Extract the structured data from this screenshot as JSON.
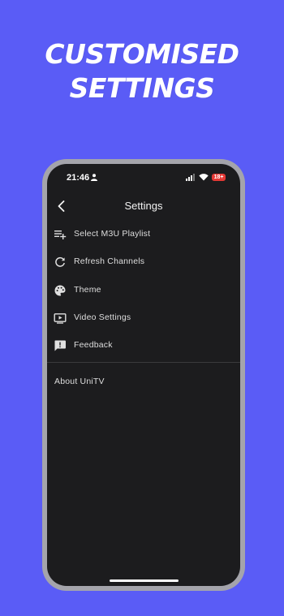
{
  "promo": {
    "line1": "CUSTOMISED",
    "line2": "SETTINGS"
  },
  "status_bar": {
    "time": "21:46",
    "battery": "18+"
  },
  "appbar": {
    "title": "Settings",
    "back_icon": "chevron-left-icon"
  },
  "menu": {
    "items": [
      {
        "label": "Select M3U Playlist",
        "icon": "playlist-add-icon"
      },
      {
        "label": "Refresh Channels",
        "icon": "refresh-icon"
      },
      {
        "label": "Theme",
        "icon": "palette-icon"
      },
      {
        "label": "Video Settings",
        "icon": "video-settings-icon"
      },
      {
        "label": "Feedback",
        "icon": "feedback-icon"
      }
    ]
  },
  "about": {
    "label": "About UniTV"
  },
  "colors": {
    "background": "#5a5cf6",
    "screen": "#1c1c1e",
    "phone_frame": "#a4a4ab",
    "text": "#dedede",
    "battery": "#e53935"
  }
}
